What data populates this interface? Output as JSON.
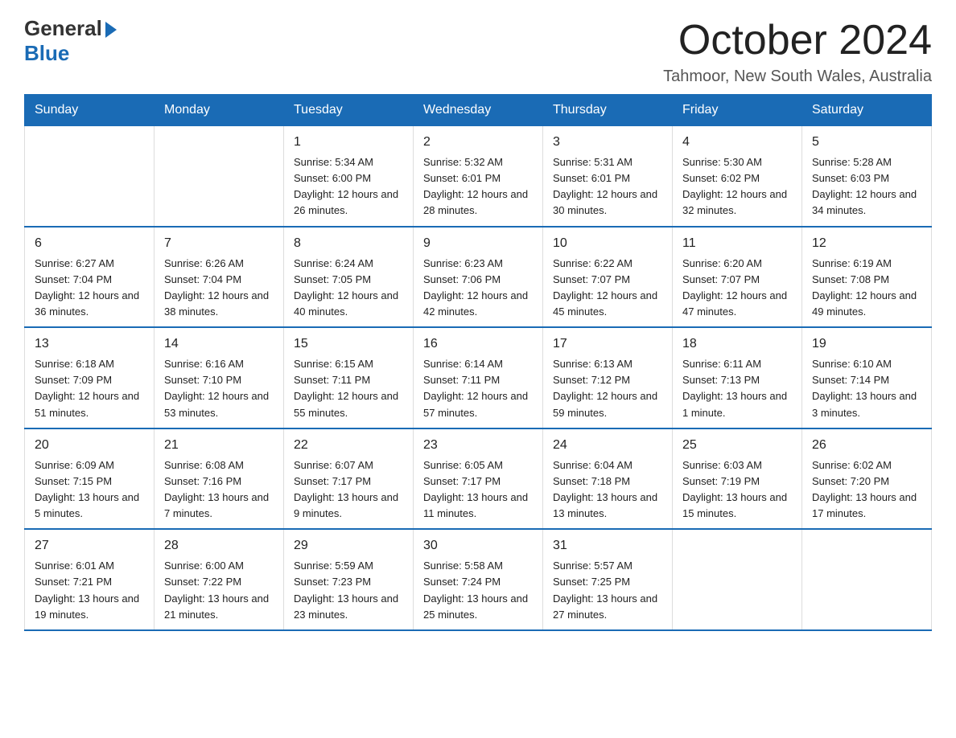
{
  "logo": {
    "general_text": "General",
    "blue_text": "Blue"
  },
  "page_title": "October 2024",
  "subtitle": "Tahmoor, New South Wales, Australia",
  "calendar": {
    "headers": [
      "Sunday",
      "Monday",
      "Tuesday",
      "Wednesday",
      "Thursday",
      "Friday",
      "Saturday"
    ],
    "weeks": [
      [
        {
          "day": "",
          "info": ""
        },
        {
          "day": "",
          "info": ""
        },
        {
          "day": "1",
          "info": "Sunrise: 5:34 AM\nSunset: 6:00 PM\nDaylight: 12 hours\nand 26 minutes."
        },
        {
          "day": "2",
          "info": "Sunrise: 5:32 AM\nSunset: 6:01 PM\nDaylight: 12 hours\nand 28 minutes."
        },
        {
          "day": "3",
          "info": "Sunrise: 5:31 AM\nSunset: 6:01 PM\nDaylight: 12 hours\nand 30 minutes."
        },
        {
          "day": "4",
          "info": "Sunrise: 5:30 AM\nSunset: 6:02 PM\nDaylight: 12 hours\nand 32 minutes."
        },
        {
          "day": "5",
          "info": "Sunrise: 5:28 AM\nSunset: 6:03 PM\nDaylight: 12 hours\nand 34 minutes."
        }
      ],
      [
        {
          "day": "6",
          "info": "Sunrise: 6:27 AM\nSunset: 7:04 PM\nDaylight: 12 hours\nand 36 minutes."
        },
        {
          "day": "7",
          "info": "Sunrise: 6:26 AM\nSunset: 7:04 PM\nDaylight: 12 hours\nand 38 minutes."
        },
        {
          "day": "8",
          "info": "Sunrise: 6:24 AM\nSunset: 7:05 PM\nDaylight: 12 hours\nand 40 minutes."
        },
        {
          "day": "9",
          "info": "Sunrise: 6:23 AM\nSunset: 7:06 PM\nDaylight: 12 hours\nand 42 minutes."
        },
        {
          "day": "10",
          "info": "Sunrise: 6:22 AM\nSunset: 7:07 PM\nDaylight: 12 hours\nand 45 minutes."
        },
        {
          "day": "11",
          "info": "Sunrise: 6:20 AM\nSunset: 7:07 PM\nDaylight: 12 hours\nand 47 minutes."
        },
        {
          "day": "12",
          "info": "Sunrise: 6:19 AM\nSunset: 7:08 PM\nDaylight: 12 hours\nand 49 minutes."
        }
      ],
      [
        {
          "day": "13",
          "info": "Sunrise: 6:18 AM\nSunset: 7:09 PM\nDaylight: 12 hours\nand 51 minutes."
        },
        {
          "day": "14",
          "info": "Sunrise: 6:16 AM\nSunset: 7:10 PM\nDaylight: 12 hours\nand 53 minutes."
        },
        {
          "day": "15",
          "info": "Sunrise: 6:15 AM\nSunset: 7:11 PM\nDaylight: 12 hours\nand 55 minutes."
        },
        {
          "day": "16",
          "info": "Sunrise: 6:14 AM\nSunset: 7:11 PM\nDaylight: 12 hours\nand 57 minutes."
        },
        {
          "day": "17",
          "info": "Sunrise: 6:13 AM\nSunset: 7:12 PM\nDaylight: 12 hours\nand 59 minutes."
        },
        {
          "day": "18",
          "info": "Sunrise: 6:11 AM\nSunset: 7:13 PM\nDaylight: 13 hours\nand 1 minute."
        },
        {
          "day": "19",
          "info": "Sunrise: 6:10 AM\nSunset: 7:14 PM\nDaylight: 13 hours\nand 3 minutes."
        }
      ],
      [
        {
          "day": "20",
          "info": "Sunrise: 6:09 AM\nSunset: 7:15 PM\nDaylight: 13 hours\nand 5 minutes."
        },
        {
          "day": "21",
          "info": "Sunrise: 6:08 AM\nSunset: 7:16 PM\nDaylight: 13 hours\nand 7 minutes."
        },
        {
          "day": "22",
          "info": "Sunrise: 6:07 AM\nSunset: 7:17 PM\nDaylight: 13 hours\nand 9 minutes."
        },
        {
          "day": "23",
          "info": "Sunrise: 6:05 AM\nSunset: 7:17 PM\nDaylight: 13 hours\nand 11 minutes."
        },
        {
          "day": "24",
          "info": "Sunrise: 6:04 AM\nSunset: 7:18 PM\nDaylight: 13 hours\nand 13 minutes."
        },
        {
          "day": "25",
          "info": "Sunrise: 6:03 AM\nSunset: 7:19 PM\nDaylight: 13 hours\nand 15 minutes."
        },
        {
          "day": "26",
          "info": "Sunrise: 6:02 AM\nSunset: 7:20 PM\nDaylight: 13 hours\nand 17 minutes."
        }
      ],
      [
        {
          "day": "27",
          "info": "Sunrise: 6:01 AM\nSunset: 7:21 PM\nDaylight: 13 hours\nand 19 minutes."
        },
        {
          "day": "28",
          "info": "Sunrise: 6:00 AM\nSunset: 7:22 PM\nDaylight: 13 hours\nand 21 minutes."
        },
        {
          "day": "29",
          "info": "Sunrise: 5:59 AM\nSunset: 7:23 PM\nDaylight: 13 hours\nand 23 minutes."
        },
        {
          "day": "30",
          "info": "Sunrise: 5:58 AM\nSunset: 7:24 PM\nDaylight: 13 hours\nand 25 minutes."
        },
        {
          "day": "31",
          "info": "Sunrise: 5:57 AM\nSunset: 7:25 PM\nDaylight: 13 hours\nand 27 minutes."
        },
        {
          "day": "",
          "info": ""
        },
        {
          "day": "",
          "info": ""
        }
      ]
    ]
  }
}
